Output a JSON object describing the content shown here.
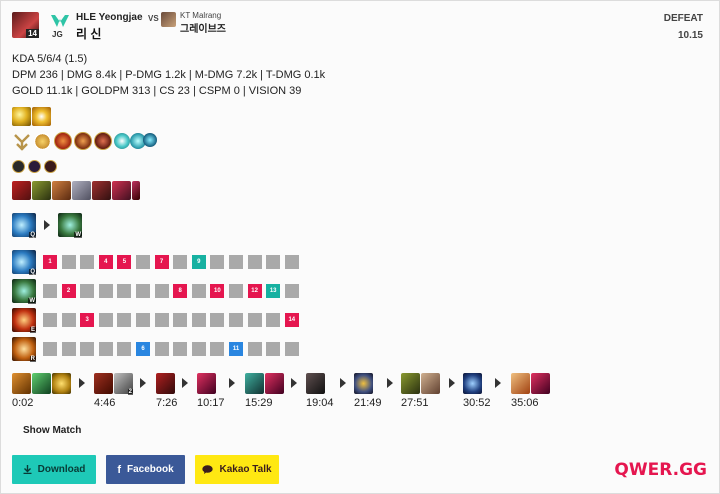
{
  "header": {
    "level": "14",
    "role": "JG",
    "player_name": "HLE Yeongjae",
    "champion": "리 신",
    "vs_label": "VS",
    "opponent_name": "KT Malrang",
    "opponent_champion": "그레이브즈",
    "result": "DEFEAT",
    "patch": "10.15"
  },
  "stats": {
    "line1": "KDA 5/6/4 (1.5)",
    "line2": "DPM 236 | DMG 8.4k | P-DMG 1.2k | M-DMG 7.2k | T-DMG 0.1k",
    "line3": "GOLD 11.1k | GOLDPM 313 | CS 23 | CSPM 0 | VISION 39"
  },
  "skill_order": {
    "keys": [
      "Q",
      "W",
      "E",
      "R"
    ],
    "rows": [
      {
        "key": "Q",
        "levels": [
          "1",
          "4",
          "5",
          "7",
          "9"
        ]
      },
      {
        "key": "W",
        "levels": [
          "2",
          "8",
          "10",
          "12",
          "13"
        ]
      },
      {
        "key": "E",
        "levels": [
          "3",
          "14"
        ]
      },
      {
        "key": "R",
        "levels": [
          "6",
          "11"
        ]
      }
    ],
    "max_order": [
      "Q",
      "W"
    ]
  },
  "build": {
    "times": [
      "0:02",
      "4:46",
      "7:26",
      "10:17",
      "15:29",
      "19:04",
      "21:49",
      "27:51",
      "30:52",
      "35:06"
    ],
    "badge": "2"
  },
  "actions": {
    "show_match": "Show Match",
    "download": "Download",
    "facebook": "Facebook",
    "kakao": "Kakao Talk"
  },
  "brand": "QWER.GG",
  "colors": {
    "accent": "#e5164f",
    "teal": "#17b1a1",
    "blue": "#2a86e0",
    "download_btn": "#1ec9b7",
    "facebook_btn": "#3b5998",
    "kakao_btn": "#ffe812"
  }
}
